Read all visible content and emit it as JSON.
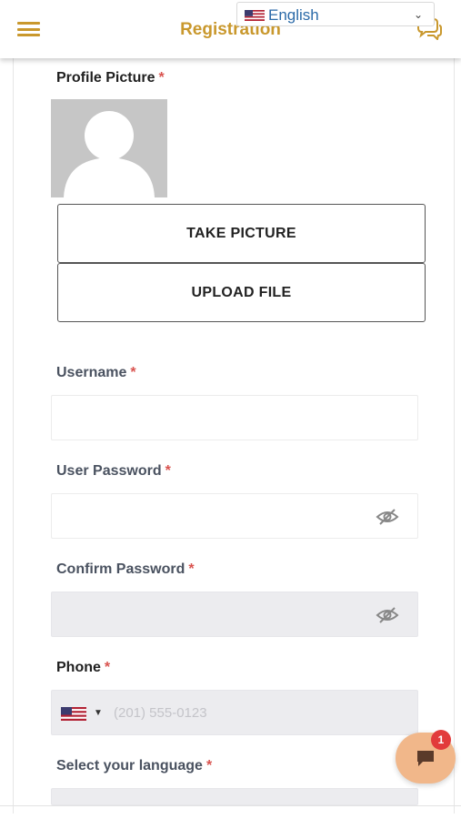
{
  "header": {
    "title": "Registration",
    "language": {
      "selected": "English"
    }
  },
  "form": {
    "profile_picture": {
      "label": "Profile Picture",
      "required": "*"
    },
    "take_picture_label": "TAKE PICTURE",
    "upload_file_label": "UPLOAD FILE",
    "username": {
      "label": "Username",
      "required": "*",
      "value": ""
    },
    "user_password": {
      "label": "User Password",
      "required": "*",
      "value": ""
    },
    "confirm_password": {
      "label": "Confirm Password",
      "required": "*",
      "value": ""
    },
    "phone": {
      "label": "Phone",
      "required": "*",
      "placeholder": "(201) 555-0123"
    },
    "language": {
      "label": "Select your language",
      "required": "*"
    }
  },
  "chat": {
    "badge_count": "1"
  },
  "colors": {
    "accent": "#c9982d",
    "required": "#d9534f",
    "chat_bg": "#f1b78a",
    "badge": "#e23b3b"
  }
}
